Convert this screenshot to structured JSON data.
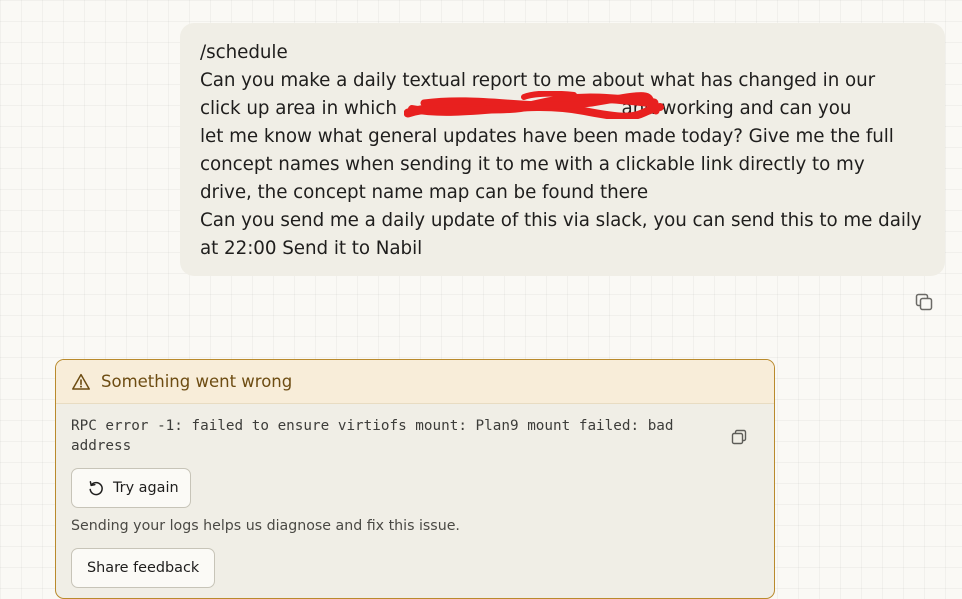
{
  "user_message": {
    "lines": [
      "/schedule",
      "Can you make a daily textual report to me about what has changed in our",
      "click up area in which                                       and working and can you",
      "let me know what general updates have been made today? Give me the full",
      "concept names when sending it to me with a clickable link directly to my",
      "drive, the concept name map can be found there",
      "Can you send me a daily update of this via slack, you can send this to me daily",
      "at 22:00 Send it to Nabil"
    ],
    "copy_icon": "copy-icon"
  },
  "error": {
    "title": "Something went wrong",
    "icon": "warning-triangle-icon",
    "message": "RPC error -1: failed to ensure virtiofs mount: Plan9 mount failed: bad address",
    "copy_icon": "copy-icon",
    "try_again_label": "Try again",
    "try_again_icon": "retry-icon",
    "help_text": "Sending your logs helps us diagnose and fix this issue.",
    "share_feedback_label": "Share feedback"
  },
  "colors": {
    "page_background": "#faf9f5",
    "bubble_background": "#f0eee6",
    "error_header_background": "#f8edd9",
    "error_border": "#b98a2c",
    "error_title": "#6d4c12",
    "redaction": "#e8201f"
  }
}
